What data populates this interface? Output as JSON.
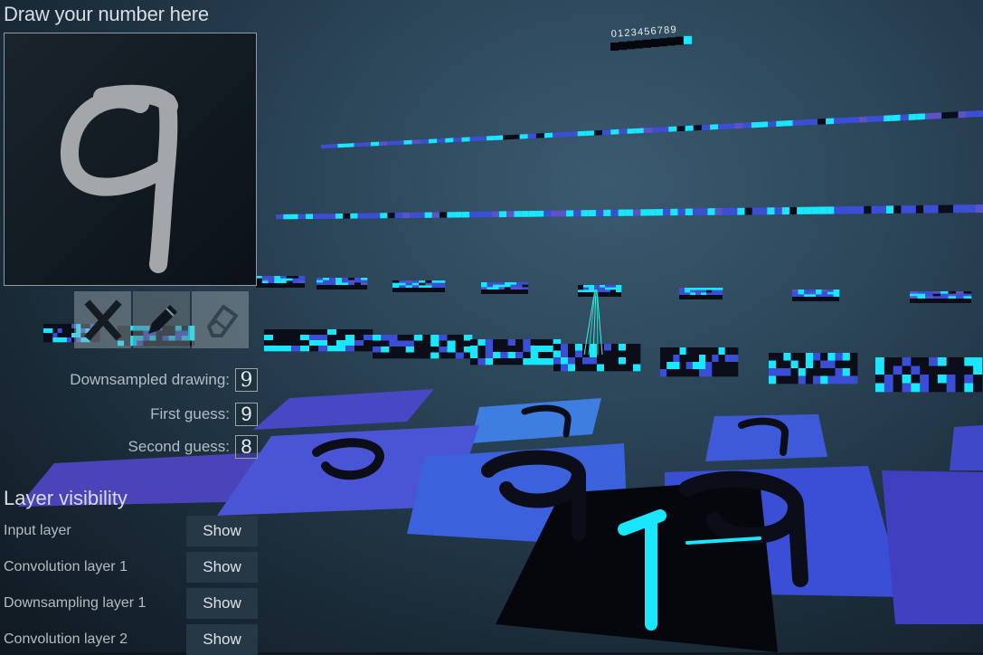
{
  "header": {
    "title": "Draw your number here"
  },
  "tools": {
    "clear_icon": "x-icon",
    "pencil_icon": "pencil-icon",
    "eraser_icon": "eraser-icon"
  },
  "guesses": {
    "downsampled_label": "Downsampled drawing:",
    "downsampled_value": "9",
    "first_label": "First guess:",
    "first_value": "9",
    "second_label": "Second guess:",
    "second_value": "8"
  },
  "visibility": {
    "title": "Layer visibility",
    "layers": [
      {
        "label": "Input layer",
        "button": "Show"
      },
      {
        "label": "Convolution layer 1",
        "button": "Show"
      },
      {
        "label": "Downsampling layer 1",
        "button": "Show"
      },
      {
        "label": "Convolution layer 2",
        "button": "Show"
      }
    ]
  },
  "output_layer": {
    "digits": "0123456789",
    "highlighted_digit": 9
  },
  "colors": {
    "cyan": "#19e6ff",
    "blue": "#3a4fd6",
    "dark": "#0b0e18",
    "panel_text": "#b4bcc3"
  }
}
